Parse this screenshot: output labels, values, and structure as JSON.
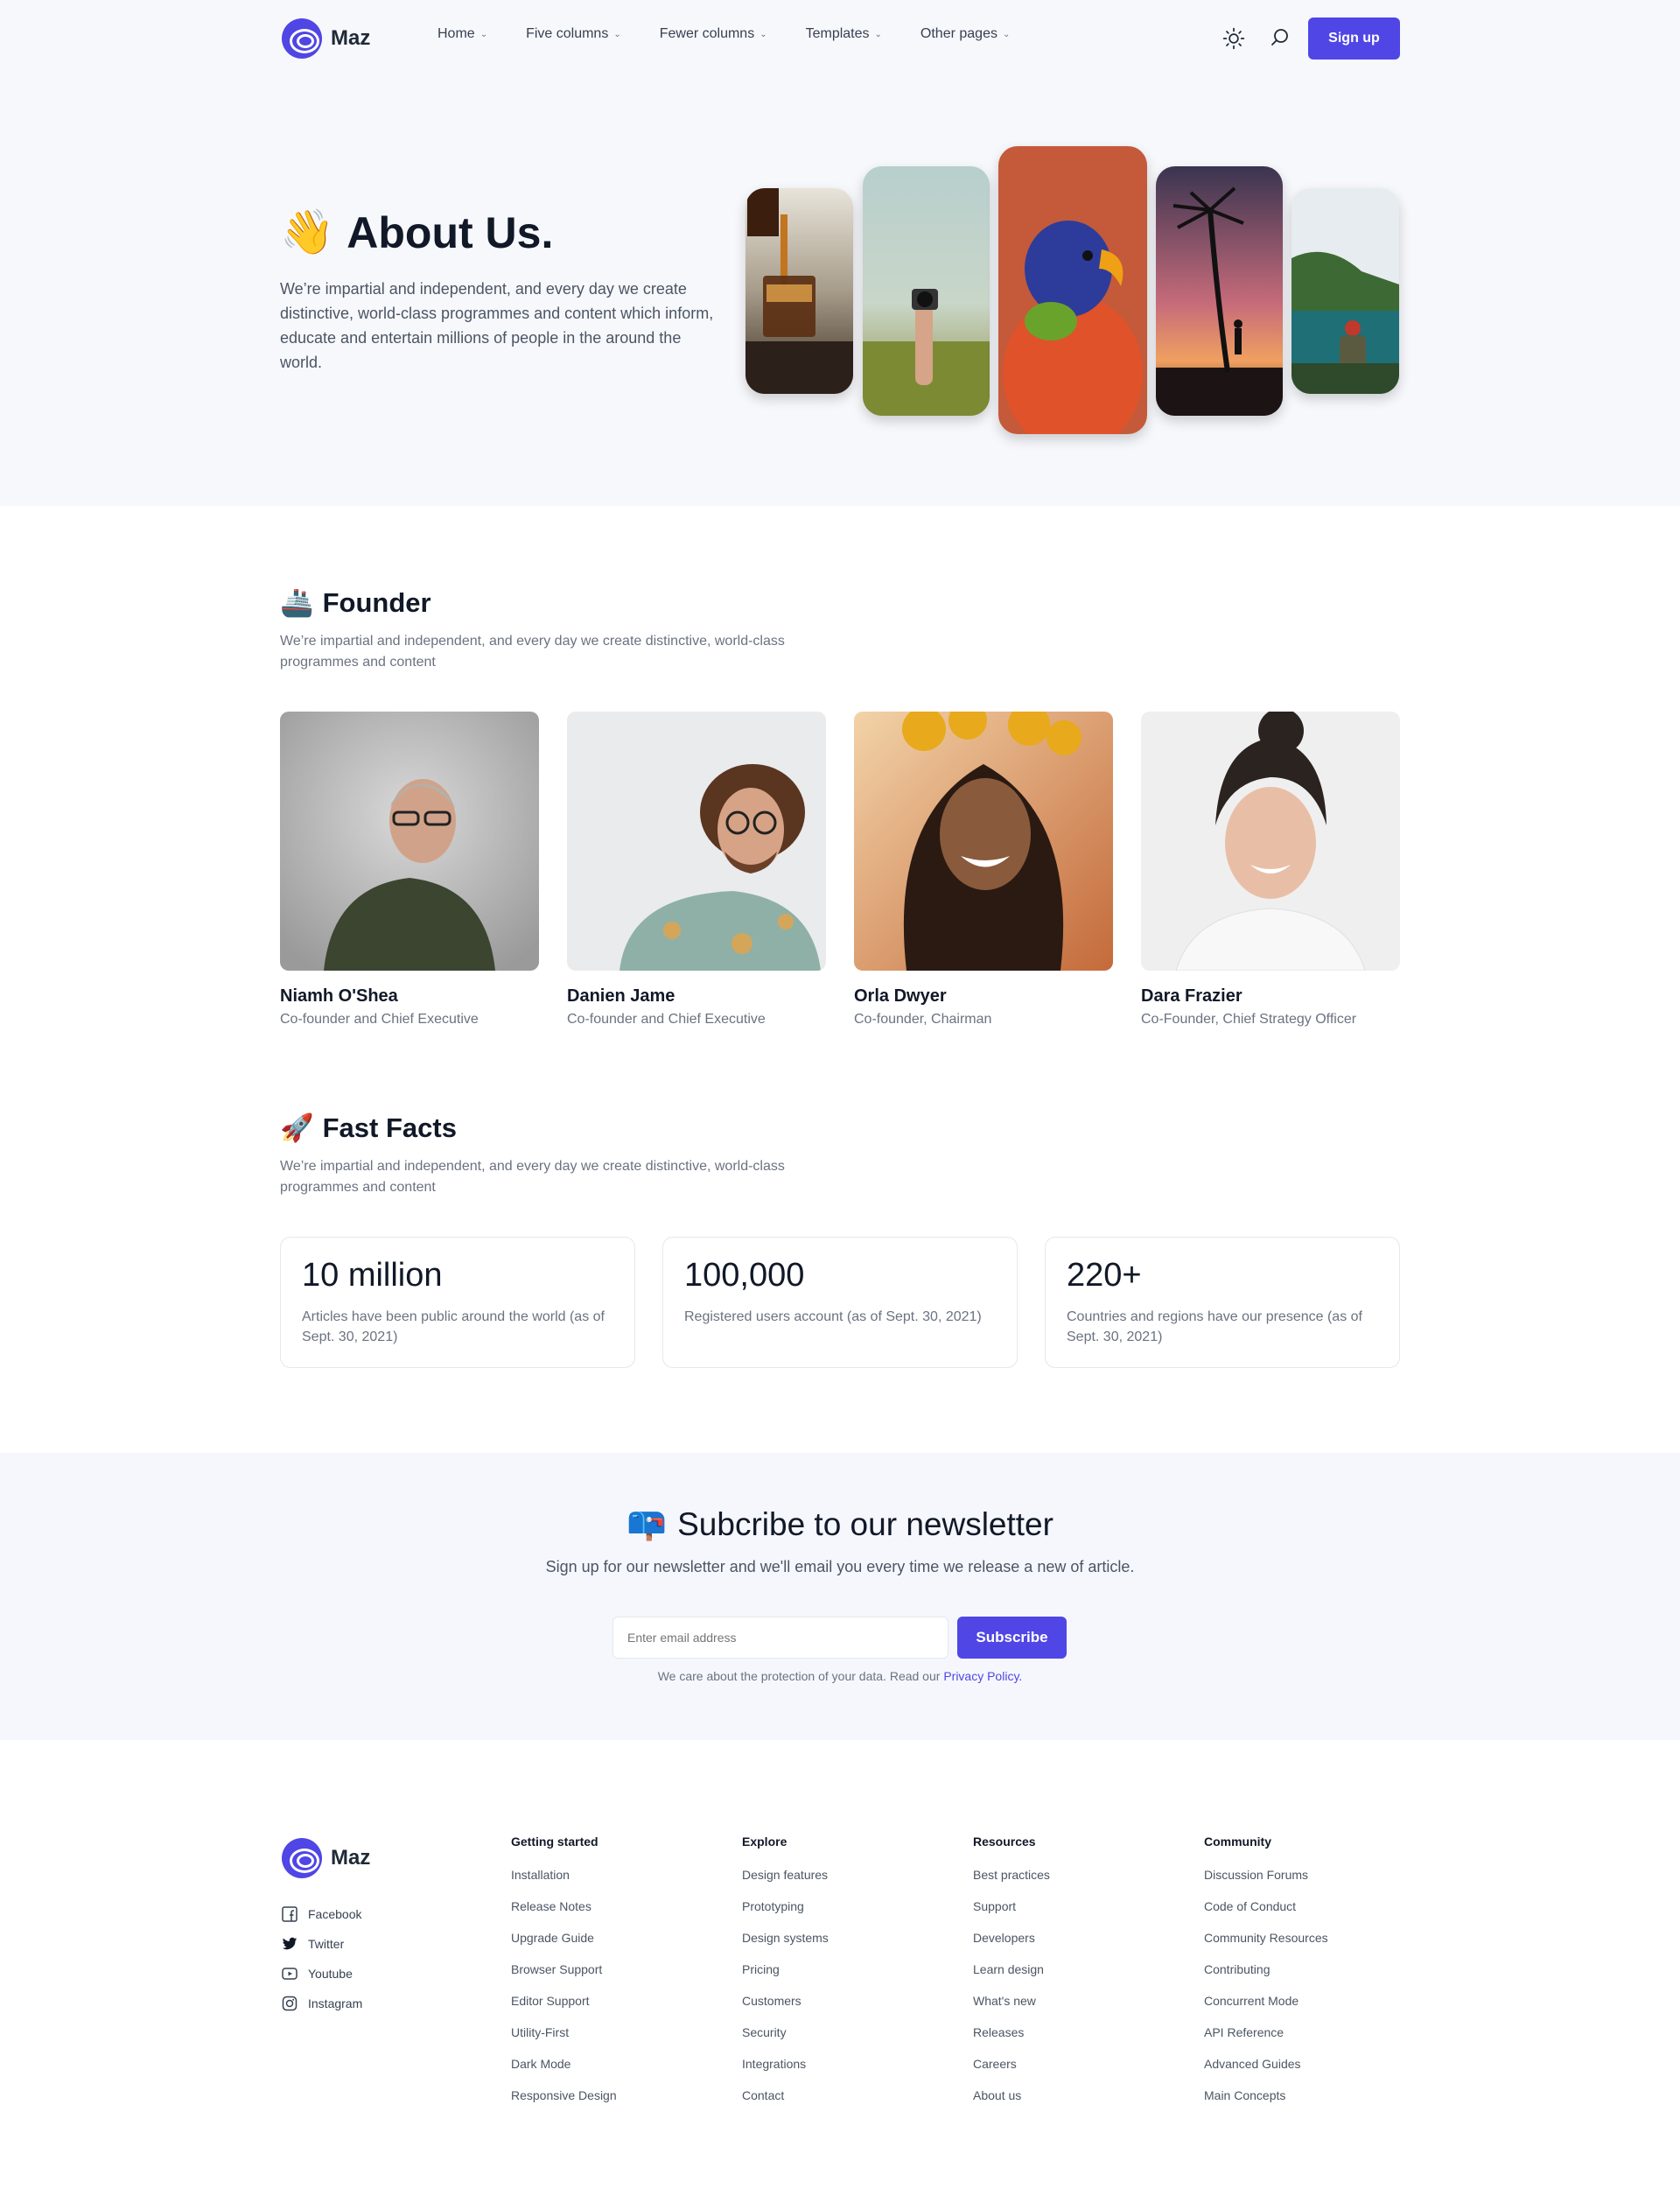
{
  "brand": {
    "name": "Maz",
    "accent": "#4f46e5"
  },
  "nav": {
    "items": [
      {
        "label": "Home"
      },
      {
        "label": "Five columns"
      },
      {
        "label": "Fewer columns"
      },
      {
        "label": "Templates"
      },
      {
        "label": "Other pages"
      }
    ],
    "signup_label": "Sign up"
  },
  "hero": {
    "emoji": "👋",
    "title": "About Us.",
    "description": "We’re impartial and independent, and every day we create distinctive, world-class programmes and content which inform, educate and entertain millions of people in the around the world."
  },
  "founder": {
    "emoji": "🚢",
    "title": "Founder",
    "description": "We’re impartial and independent, and every day we create distinctive, world-class programmes and content",
    "people": [
      {
        "name": "Niamh O'Shea",
        "role": "Co-founder and Chief Executive"
      },
      {
        "name": "Danien Jame",
        "role": "Co-founder and Chief Executive"
      },
      {
        "name": "Orla Dwyer",
        "role": "Co-founder, Chairman"
      },
      {
        "name": "Dara Frazier",
        "role": "Co-Founder, Chief Strategy Officer"
      }
    ]
  },
  "facts": {
    "emoji": "🚀",
    "title": "Fast Facts",
    "description": "We’re impartial and independent, and every day we create distinctive, world-class programmes and content",
    "items": [
      {
        "value": "10 million",
        "text": "Articles have been public around the world (as of Sept. 30, 2021)"
      },
      {
        "value": "100,000",
        "text": "Registered users account (as of Sept. 30, 2021)"
      },
      {
        "value": "220+",
        "text": "Countries and regions have our presence (as of Sept. 30, 2021)"
      }
    ]
  },
  "newsletter": {
    "emoji": "📪",
    "title": "Subcribe to our newsletter",
    "description": "Sign up for our newsletter and we'll email you every time we release a new of article.",
    "placeholder": "Enter email address",
    "button_label": "Subscribe",
    "note": "We care about the protection of your data. Read our",
    "policy_link": "Privacy Policy."
  },
  "footer": {
    "social": [
      {
        "label": "Facebook",
        "icon": "facebook-icon"
      },
      {
        "label": "Twitter",
        "icon": "twitter-icon"
      },
      {
        "label": "Youtube",
        "icon": "youtube-icon"
      },
      {
        "label": "Instagram",
        "icon": "instagram-icon"
      }
    ],
    "columns": [
      {
        "title": "Getting started",
        "links": [
          "Installation",
          "Release Notes",
          "Upgrade Guide",
          "Browser Support",
          "Editor Support",
          "Utility-First",
          "Dark Mode",
          "Responsive Design"
        ]
      },
      {
        "title": "Explore",
        "links": [
          "Design features",
          "Prototyping",
          "Design systems",
          "Pricing",
          "Customers",
          "Security",
          "Integrations",
          "Contact"
        ]
      },
      {
        "title": "Resources",
        "links": [
          "Best practices",
          "Support",
          "Developers",
          "Learn design",
          "What's new",
          "Releases",
          "Careers",
          "About us"
        ]
      },
      {
        "title": "Community",
        "links": [
          "Discussion Forums",
          "Code of Conduct",
          "Community Resources",
          "Contributing",
          "Concurrent Mode",
          "API Reference",
          "Advanced Guides",
          "Main Concepts"
        ]
      }
    ]
  }
}
